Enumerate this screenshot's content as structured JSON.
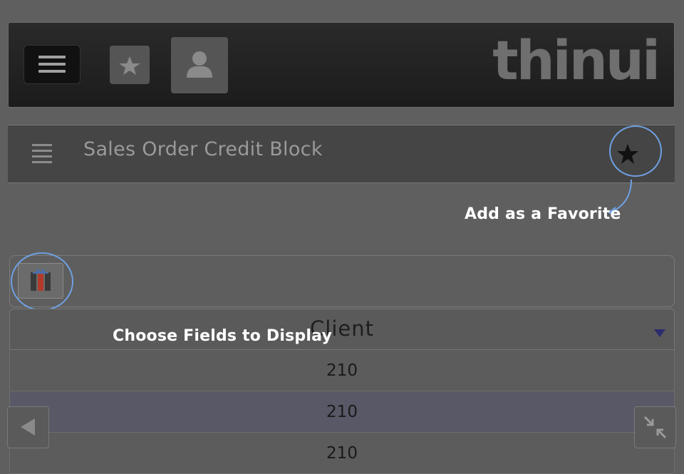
{
  "app": {
    "logo_text": "thinui",
    "title": "Sales Order Credit Block"
  },
  "annotations": {
    "favorite_hint": "Add as a Favorite",
    "fields_hint": "Choose Fields to Display",
    "accent_color": "#6fa0e2"
  },
  "table": {
    "column_header": "Client",
    "rows": [
      "210",
      "210",
      "210"
    ]
  },
  "icons": {
    "menu": "hamburger-icon",
    "favorite": "star-icon",
    "user": "user-icon",
    "fields": "columns-icon",
    "back": "back-arrow-icon",
    "collapse": "collapse-icon"
  }
}
